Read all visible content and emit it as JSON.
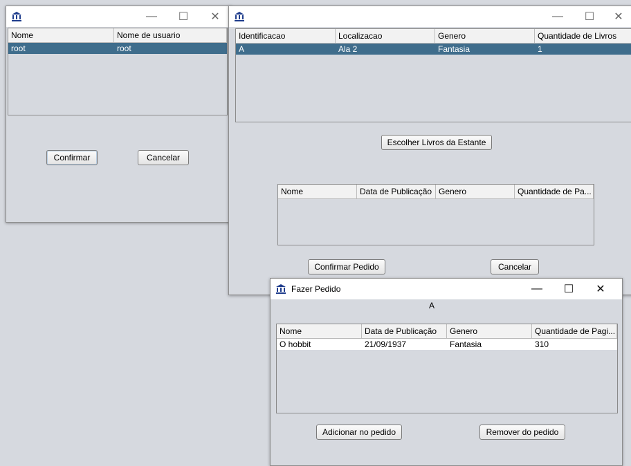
{
  "colors": {
    "selection": "#3f6d8c",
    "background": "#d6d9df",
    "titlebar": "#ffffff"
  },
  "controls": {
    "minimize": "—",
    "maximize": "☐",
    "close": "✕"
  },
  "user_window": {
    "title": "",
    "columns": [
      "Nome",
      "Nome de usuario"
    ],
    "rows": [
      [
        "root",
        "root"
      ]
    ],
    "confirm_label": "Confirmar",
    "cancel_label": "Cancelar"
  },
  "shelf_window": {
    "title": "",
    "shelf_columns": [
      "Identificacao",
      "Localizacao",
      "Genero",
      "Quantidade de Livros"
    ],
    "shelf_rows": [
      [
        "A",
        "Ala 2",
        "Fantasia",
        "1"
      ]
    ],
    "choose_books_label": "Escolher Livros da Estante",
    "book_columns": [
      "Nome",
      "Data de Publicação",
      "Genero",
      "Quantidade de Pa..."
    ],
    "confirm_order_label": "Confirmar Pedido",
    "cancel_label": "Cancelar"
  },
  "order_window": {
    "title": "Fazer Pedido",
    "shelf_id": "A",
    "columns": [
      "Nome",
      "Data de Publicação",
      "Genero",
      "Quantidade de Pagi..."
    ],
    "rows": [
      [
        "O hobbit",
        "21/09/1937",
        "Fantasia",
        "310"
      ]
    ],
    "add_label": "Adicionar no pedido",
    "remove_label": "Remover do pedido"
  }
}
